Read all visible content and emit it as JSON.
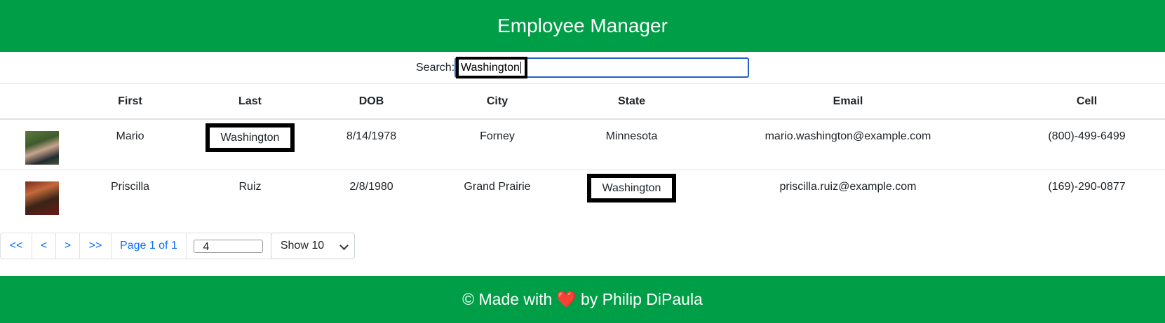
{
  "header": {
    "title": "Employee Manager"
  },
  "search": {
    "label": "Search:",
    "value": "Washington"
  },
  "table": {
    "columns": [
      "",
      "First",
      "Last",
      "DOB",
      "City",
      "State",
      "Email",
      "Cell"
    ],
    "rows": [
      {
        "first": "Mario",
        "last": "Washington",
        "dob": "8/14/1978",
        "city": "Forney",
        "state": "Minnesota",
        "email": "mario.washington@example.com",
        "cell": "(800)-499-6499"
      },
      {
        "first": "Priscilla",
        "last": "Ruiz",
        "dob": "2/8/1980",
        "city": "Grand Prairie",
        "state": "Washington",
        "email": "priscilla.ruiz@example.com",
        "cell": "(169)-290-0877"
      }
    ]
  },
  "pagination": {
    "first": "<<",
    "prev": "<",
    "next": ">",
    "last": ">>",
    "page_info": "Page 1 of 1",
    "jump_value": "4",
    "page_size": "Show 10"
  },
  "footer": {
    "prefix": "© Made with",
    "heart": "❤️",
    "suffix": "by Philip DiPaula"
  }
}
